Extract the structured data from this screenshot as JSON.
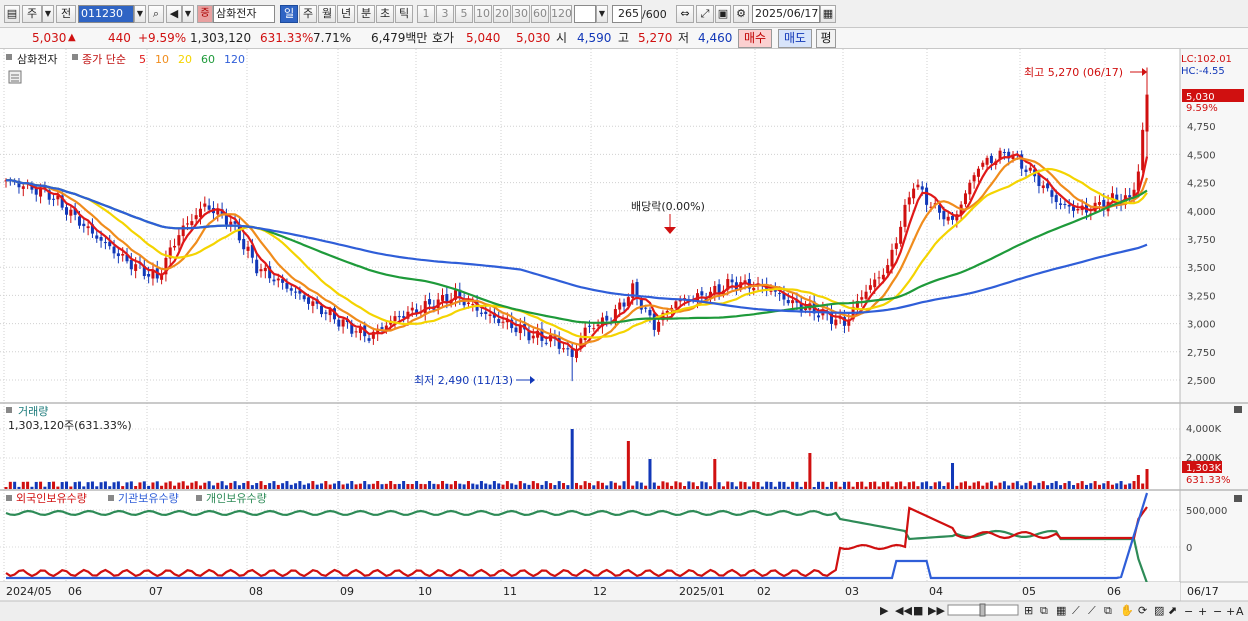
{
  "toolbar": {
    "period_type": "주",
    "prev_btn": "전",
    "code": "011230",
    "stock_name": "삼화전자",
    "stock_badge": "증",
    "periods": [
      "일",
      "주",
      "월",
      "년",
      "분",
      "초",
      "틱"
    ],
    "selected_period": "일",
    "intervals": [
      "1",
      "3",
      "5",
      "10",
      "20",
      "30",
      "60",
      "120"
    ],
    "count": "265",
    "count_total": "/600",
    "date": "2025/06/17"
  },
  "quote": {
    "price": "5,030",
    "change": "440",
    "change_pct": "+9.59%",
    "volume": "1,303,120",
    "volume_ratio": "631.33%",
    "turnover": "7.71%",
    "amount": "6,479백만",
    "bid_label": "호가",
    "bid1": "5,040",
    "bid2": "5,030",
    "open_label": "시",
    "open": "4,590",
    "high_label": "고",
    "high": "5,270",
    "low_label": "저",
    "low": "4,460",
    "buy_label": "매수",
    "sell_label": "매도",
    "eval_label": "평"
  },
  "price_panel": {
    "stock_name": "삼화전자",
    "ma_title": "종가 단순",
    "ma_periods": [
      {
        "label": "5",
        "color": "#e01818"
      },
      {
        "label": "10",
        "color": "#f08c1c"
      },
      {
        "label": "20",
        "color": "#f4d400"
      },
      {
        "label": "60",
        "color": "#1e9a3a"
      },
      {
        "label": "120",
        "color": "#2f5ed8"
      }
    ],
    "high_annotation": "최고 5,270 (06/17)",
    "low_annotation": "최저 2,490 (11/13)",
    "event_annotation": "배당락(0.00%)",
    "lc_label": "LC:102.01",
    "hc_label": "HC:-4.55",
    "current_price": "5,030",
    "current_pct": "9.59%",
    "y_ticks": [
      "4,750",
      "4,500",
      "4,250",
      "4,000",
      "3,750",
      "3,500",
      "3,250",
      "3,000",
      "2,750",
      "2,500"
    ]
  },
  "volume_panel": {
    "title": "거래량",
    "value": "1,303,120주(631.33%)",
    "y_ticks": [
      "4,000K",
      "2,000K"
    ],
    "current": "1,303K",
    "current_pct": "631.33%"
  },
  "holding_panel": {
    "series": [
      {
        "label": "외국인보유수량",
        "color": "#d01010"
      },
      {
        "label": "기관보유수량",
        "color": "#2f5ed8"
      },
      {
        "label": "개인보유수량",
        "color": "#2e8b57"
      }
    ],
    "y_ticks": [
      "500,000",
      "0"
    ]
  },
  "x_axis": {
    "labels": [
      "2024/05",
      "06",
      "07",
      "08",
      "09",
      "10",
      "11",
      "12",
      "2025/01",
      "02",
      "03",
      "04",
      "05",
      "06"
    ],
    "end_label": "06/17"
  },
  "chart_data": {
    "type": "candlestick",
    "title": "삼화전자",
    "series": [
      {
        "name": "5",
        "type": "line"
      },
      {
        "name": "10",
        "type": "line"
      },
      {
        "name": "20",
        "type": "line"
      },
      {
        "name": "60",
        "type": "line"
      },
      {
        "name": "120",
        "type": "line"
      }
    ],
    "x": [
      "2024/05",
      "06",
      "07",
      "08",
      "09",
      "10",
      "11",
      "12",
      "2025/01",
      "02",
      "03",
      "04",
      "05",
      "06"
    ],
    "close_by_month": [
      4250,
      3450,
      3950,
      3200,
      2850,
      3100,
      2650,
      3200,
      3250,
      3100,
      3500,
      4300,
      4400,
      4050
    ],
    "ylim": [
      2400,
      5300
    ],
    "high": 5270,
    "low": 2490,
    "last": 5030
  },
  "colors": {
    "up": "#d01010",
    "down": "#1238b8",
    "accent": "#2f64c4"
  }
}
